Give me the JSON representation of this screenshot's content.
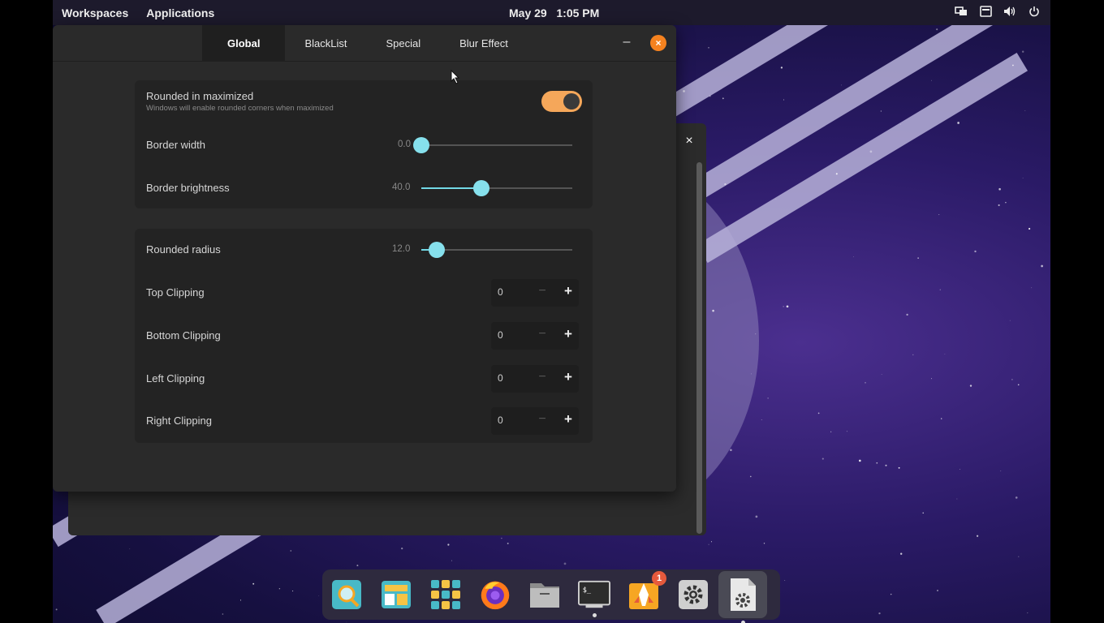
{
  "topbar": {
    "workspaces": "Workspaces",
    "applications": "Applications",
    "clock": "May 29   1:05 PM",
    "tray": [
      "display-icon",
      "keyboard-icon",
      "volume-icon",
      "power-icon"
    ]
  },
  "window": {
    "tabs": [
      "Global",
      "BlackList",
      "Special",
      "Blur Effect"
    ],
    "active_tab": "Global",
    "minimize_label": "–",
    "close_label": "×",
    "group1": {
      "rounded_maximized": {
        "label": "Rounded in maximized",
        "sublabel": "Windows will enable rounded corners when maximized",
        "enabled": true
      },
      "border_width": {
        "label": "Border width",
        "value": "0.0",
        "fraction": 0.0
      },
      "border_brightness": {
        "label": "Border brightness",
        "value": "40.0",
        "fraction": 0.4
      }
    },
    "group2": {
      "rounded_radius": {
        "label": "Rounded radius",
        "value": "12.0",
        "fraction": 0.1
      },
      "clipping": [
        {
          "label": "Top Clipping",
          "value": "0"
        },
        {
          "label": "Bottom Clipping",
          "value": "0"
        },
        {
          "label": "Left Clipping",
          "value": "0"
        },
        {
          "label": "Right Clipping",
          "value": "0"
        }
      ],
      "minus": "−",
      "plus": "+"
    }
  },
  "background_window": {
    "close_label": "×"
  },
  "dock": {
    "items": [
      {
        "name": "search-app-icon",
        "running": false
      },
      {
        "name": "workspaces-app-icon",
        "running": false
      },
      {
        "name": "app-grid-icon",
        "running": false
      },
      {
        "name": "firefox-icon",
        "running": false
      },
      {
        "name": "files-icon",
        "running": false
      },
      {
        "name": "terminal-icon",
        "running": true
      },
      {
        "name": "pop-shop-icon",
        "running": false,
        "badge": "1"
      },
      {
        "name": "settings-icon",
        "running": false
      },
      {
        "name": "tweaks-settings-icon",
        "running": true,
        "active": true
      }
    ]
  },
  "colors": {
    "accent_orange": "#f5821f",
    "slider_cyan": "#86e0ec",
    "toggle_on": "#f5a75a"
  }
}
